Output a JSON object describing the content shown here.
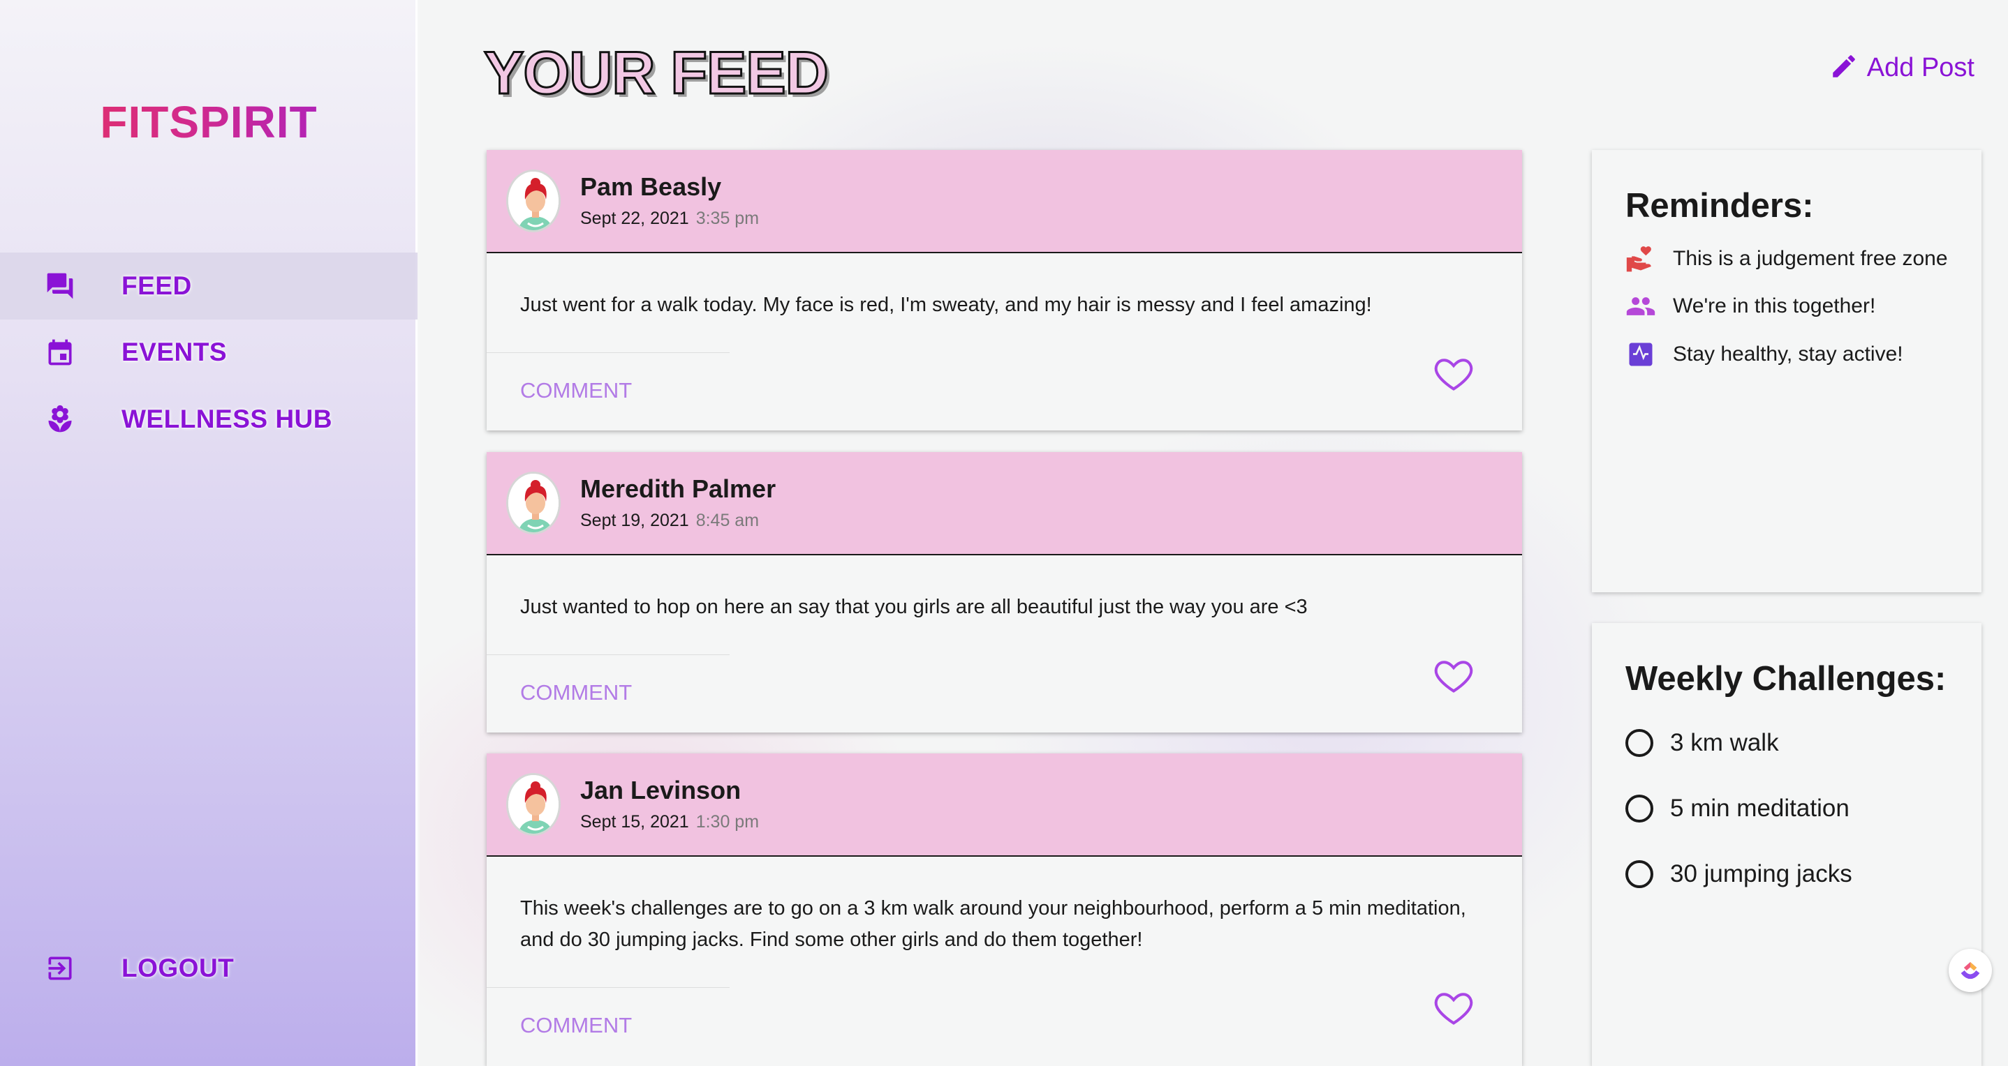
{
  "sidebar": {
    "logo": "FITSPIRIT",
    "nav": [
      {
        "label": "FEED",
        "icon": "chat-icon",
        "active": true
      },
      {
        "label": "EVENTS",
        "icon": "calendar-icon",
        "active": false
      },
      {
        "label": "WELLNESS HUB",
        "icon": "flower-icon",
        "active": false
      }
    ],
    "logout": {
      "label": "LOGOUT",
      "icon": "logout-icon"
    }
  },
  "header": {
    "title": "YOUR FEED",
    "add_post_label": "Add Post",
    "add_post_icon": "pencil-icon"
  },
  "posts": [
    {
      "author": "Pam Beasly",
      "date": "Sept 22, 2021",
      "time": "3:35 pm",
      "body": "Just went for a walk today. My face is red, I'm sweaty, and my hair is messy and I feel amazing!",
      "comment_label": "COMMENT"
    },
    {
      "author": "Meredith Palmer",
      "date": "Sept 19, 2021",
      "time": "8:45 am",
      "body": "Just wanted to hop on here an say that you girls are all beautiful just the way you are <3",
      "comment_label": "COMMENT"
    },
    {
      "author": "Jan Levinson",
      "date": "Sept 15, 2021",
      "time": "1:30 pm",
      "body": "This week's challenges are to go on a 3 km walk around your neighbourhood, perform a 5 min meditation, and do 30 jumping jacks. Find some other girls and do them together!",
      "comment_label": "COMMENT"
    }
  ],
  "reminders": {
    "title": "Reminders:",
    "items": [
      {
        "text": "This is a judgement free zone",
        "icon": "heart-hand-icon",
        "color": "#e04848"
      },
      {
        "text": "We're in this together!",
        "icon": "people-icon",
        "color": "#b548d8"
      },
      {
        "text": "Stay healthy, stay active!",
        "icon": "pulse-icon",
        "color": "#6a3fd6"
      }
    ]
  },
  "challenges": {
    "title": "Weekly Challenges:",
    "items": [
      {
        "text": "3 km walk",
        "checked": false
      },
      {
        "text": "5 min meditation",
        "checked": false
      },
      {
        "text": "30 jumping jacks",
        "checked": false
      }
    ]
  },
  "colors": {
    "accent": "#8a13d6",
    "post_header": "#f1c2e0",
    "comment": "#b27be6"
  }
}
